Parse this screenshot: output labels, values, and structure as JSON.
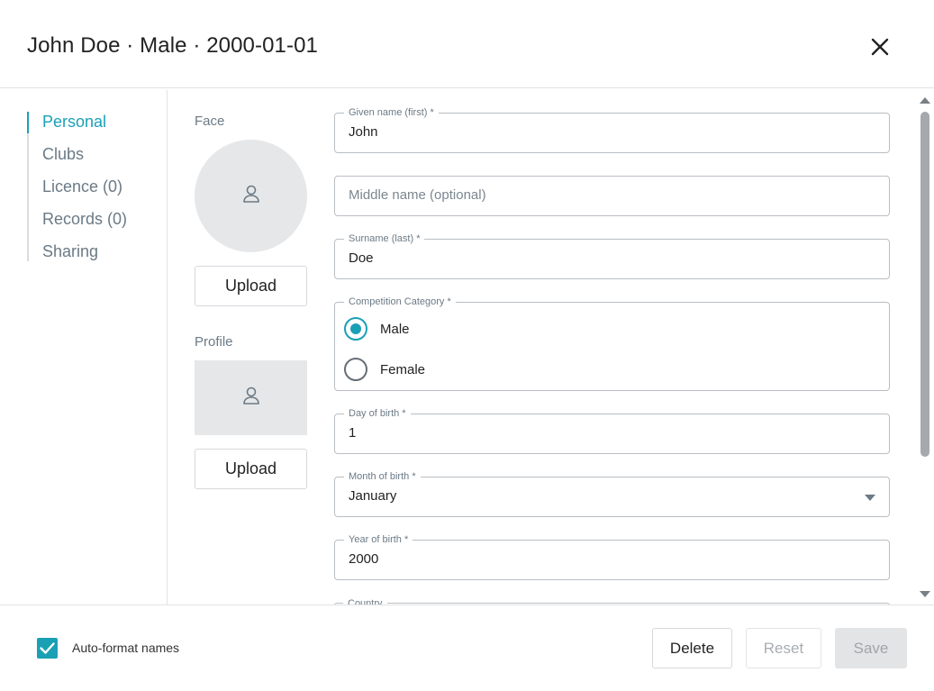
{
  "header": {
    "title": "John Doe · Male · 2000-01-01",
    "close_icon": "close-icon"
  },
  "nav": {
    "items": [
      {
        "label": "Personal",
        "active": true
      },
      {
        "label": "Clubs",
        "active": false
      },
      {
        "label": "Licence (0)",
        "active": false
      },
      {
        "label": "Records (0)",
        "active": false
      },
      {
        "label": "Sharing",
        "active": false
      }
    ]
  },
  "photos": {
    "face_label": "Face",
    "face_upload": "Upload",
    "profile_label": "Profile",
    "profile_upload": "Upload",
    "placeholder_icon": "person-icon"
  },
  "form": {
    "given_name": {
      "label": "Given name (first) *",
      "value": "John"
    },
    "middle_name": {
      "placeholder": "Middle name (optional)",
      "value": ""
    },
    "surname": {
      "label": "Surname (last) *",
      "value": "Doe"
    },
    "category": {
      "label": "Competition Category  *",
      "options": [
        {
          "label": "Male",
          "selected": true
        },
        {
          "label": "Female",
          "selected": false
        }
      ]
    },
    "day_of_birth": {
      "label": "Day of birth *",
      "value": "1"
    },
    "month_of_birth": {
      "label": "Month of birth *",
      "value": "January"
    },
    "year_of_birth": {
      "label": "Year of birth *",
      "value": "2000"
    },
    "country": {
      "label": "Country"
    }
  },
  "footer": {
    "auto_format_label": "Auto-format names",
    "auto_format_checked": true,
    "delete_label": "Delete",
    "reset_label": "Reset",
    "save_label": "Save"
  },
  "colors": {
    "accent": "#1aa0b5",
    "muted_text": "#6b7a86",
    "border": "#b9bec3"
  }
}
